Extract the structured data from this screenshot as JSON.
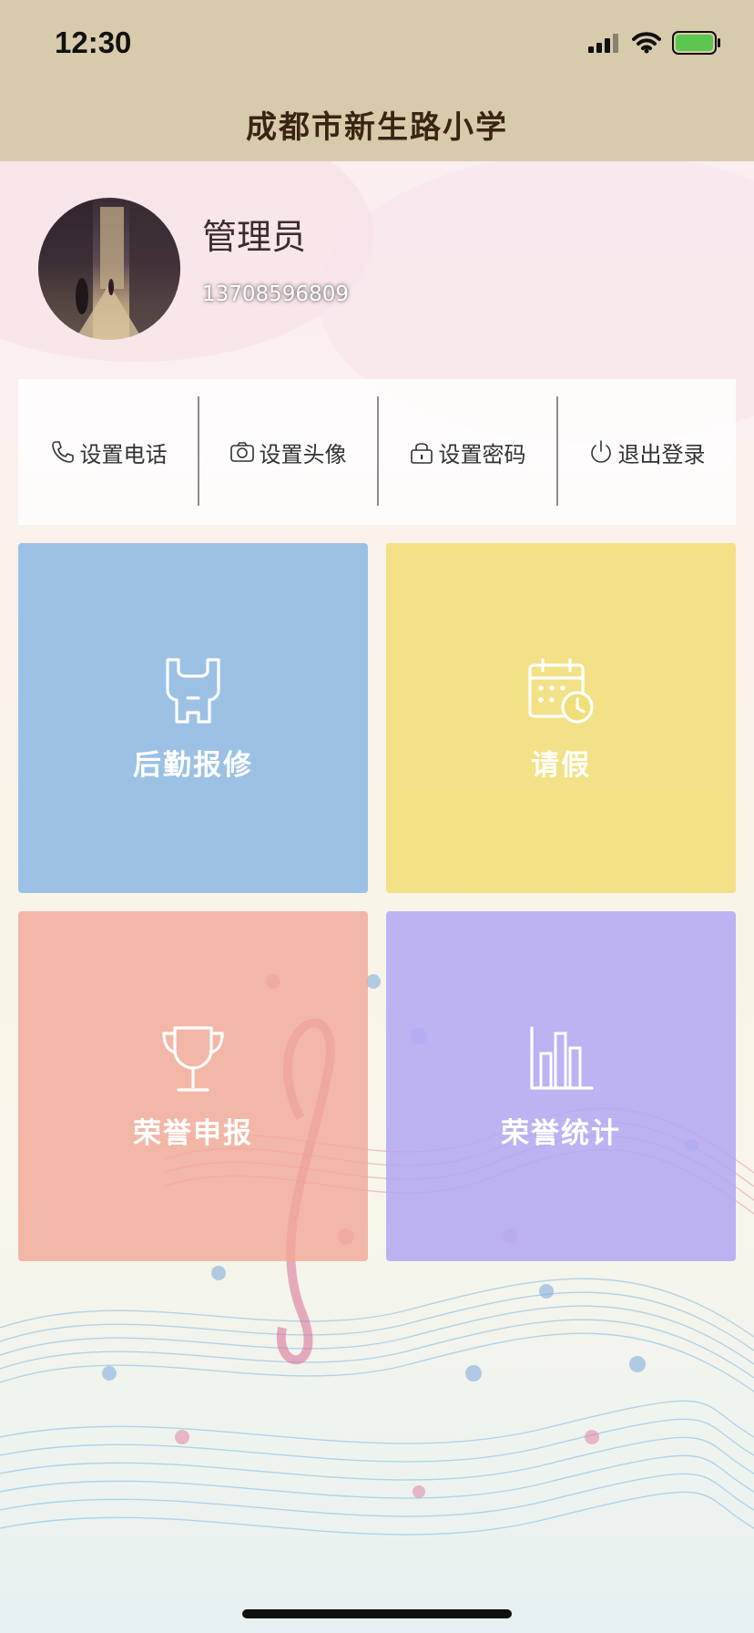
{
  "status_bar": {
    "time": "12:30"
  },
  "header": {
    "title": "成都市新生路小学"
  },
  "profile": {
    "name": "管理员",
    "phone": "13708596809"
  },
  "actions": [
    {
      "label": "设置电话",
      "icon": "phone-icon"
    },
    {
      "label": "设置头像",
      "icon": "camera-icon"
    },
    {
      "label": "设置密码",
      "icon": "lock-icon"
    },
    {
      "label": "退出登录",
      "icon": "power-icon"
    }
  ],
  "tiles": [
    {
      "label": "后勤报修",
      "icon": "wrench-icon",
      "color": "#8ebae4"
    },
    {
      "label": "请假",
      "icon": "calendar-clock-icon",
      "color": "#f0de78"
    },
    {
      "label": "荣誉申报",
      "icon": "trophy-icon",
      "color": "#f1a796"
    },
    {
      "label": "荣誉统计",
      "icon": "bar-chart-icon",
      "color": "#b4a8f2"
    }
  ]
}
